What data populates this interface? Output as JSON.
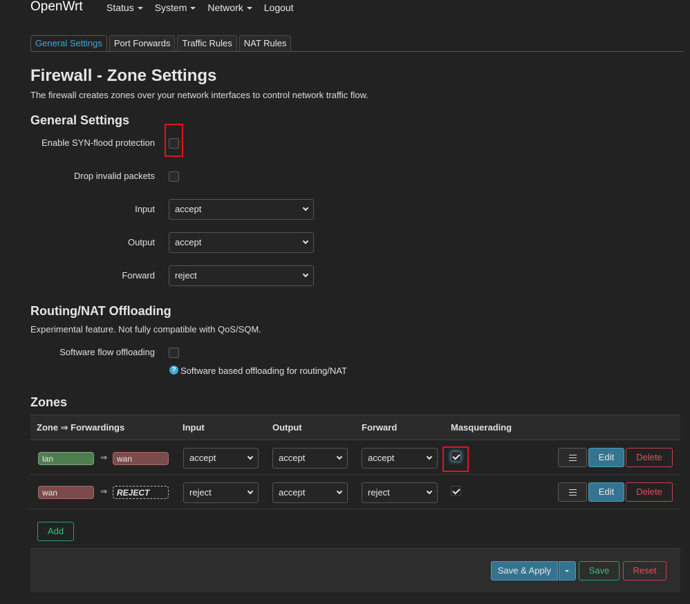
{
  "app": {
    "brand": "OpenWrt"
  },
  "nav": {
    "status": "Status",
    "system": "System",
    "network": "Network",
    "logout": "Logout"
  },
  "tabs": {
    "general": "General Settings",
    "port_forwards": "Port Forwards",
    "traffic_rules": "Traffic Rules",
    "nat_rules": "NAT Rules"
  },
  "page": {
    "title": "Firewall - Zone Settings",
    "description": "The firewall creates zones over your network interfaces to control network traffic flow."
  },
  "general_settings": {
    "title": "General Settings",
    "syn_flood_label": "Enable SYN-flood protection",
    "syn_flood_checked": false,
    "drop_invalid_label": "Drop invalid packets",
    "drop_invalid_checked": false,
    "input_label": "Input",
    "input_value": "accept",
    "output_label": "Output",
    "output_value": "accept",
    "forward_label": "Forward",
    "forward_value": "reject"
  },
  "offloading": {
    "title": "Routing/NAT Offloading",
    "description": "Experimental feature. Not fully compatible with QoS/SQM.",
    "software_flow_label": "Software flow offloading",
    "software_flow_checked": false,
    "help_text": "Software based offloading for routing/NAT"
  },
  "zones": {
    "title": "Zones",
    "headers": {
      "zone_forwardings": "Zone ⇒ Forwardings",
      "input": "Input",
      "output": "Output",
      "forward": "Forward",
      "masquerading": "Masquerading"
    },
    "rows": [
      {
        "zone": "lan",
        "arrow": "⇒",
        "forward_to": "wan",
        "input": "accept",
        "output": "accept",
        "forward": "accept",
        "masquerading": true
      },
      {
        "zone": "wan",
        "arrow": "⇒",
        "forward_to": "REJECT",
        "input": "reject",
        "output": "accept",
        "forward": "reject",
        "masquerading": true
      }
    ],
    "edit_label": "Edit",
    "delete_label": "Delete",
    "add_label": "Add"
  },
  "footer": {
    "save_apply_label": "Save & Apply",
    "save_label": "Save",
    "reset_label": "Reset"
  },
  "colors": {
    "background": "#222222",
    "accent": "#3fa7d6",
    "lan_zone": "#4f7d4f",
    "wan_zone": "#7b4a4a",
    "highlight": "#e0161b"
  },
  "icons": {
    "menu": "hamburger-menu-icon",
    "help": "question-circle-icon",
    "dropdown": "caret-down-icon",
    "check": "check-icon"
  }
}
